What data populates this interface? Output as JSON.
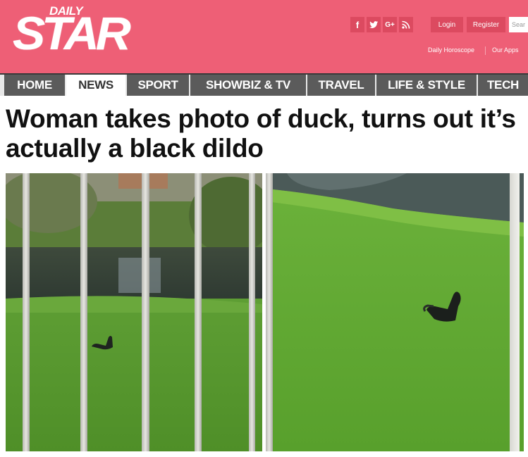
{
  "site": {
    "logo_small": "DAILY",
    "logo_big": "STAR",
    "brand_color": "#ee5f76"
  },
  "header": {
    "social": [
      {
        "icon": "facebook-icon",
        "glyph": "f"
      },
      {
        "icon": "twitter-icon",
        "glyph": "•"
      },
      {
        "icon": "google-plus-icon",
        "glyph": "G+"
      },
      {
        "icon": "rss-icon",
        "glyph": "◥"
      }
    ],
    "login_label": "Login",
    "register_label": "Register",
    "search_placeholder": "Sear",
    "horoscope_label": "Daily Horoscope",
    "apps_label": "Our Apps"
  },
  "nav": {
    "items": [
      "HOME",
      "NEWS",
      "SPORT",
      "SHOWBIZ & TV",
      "TRAVEL",
      "LIFE & STYLE",
      "TECH"
    ],
    "active": "NEWS"
  },
  "article": {
    "headline": "Woman takes photo of duck, turns out it’s actually a black dildo"
  },
  "photos": [
    {
      "name": "photo-through-fence",
      "description_icon": "image-icon"
    },
    {
      "name": "photo-closeup",
      "description_icon": "image-icon"
    }
  ]
}
